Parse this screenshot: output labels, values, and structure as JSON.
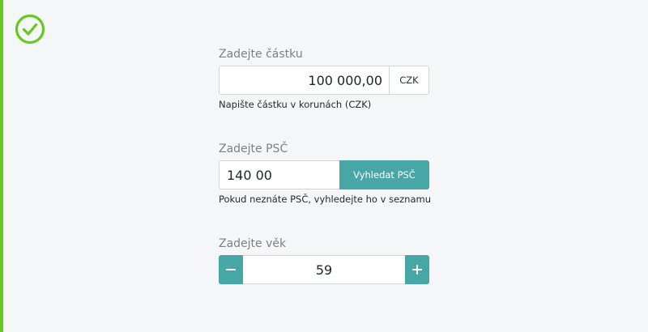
{
  "status": {
    "icon": "check-circle-icon",
    "color": "#66c91f"
  },
  "amount": {
    "label": "Zadejte částku",
    "value": "100 000,00",
    "currency": "CZK",
    "helper": "Napište částku v korunách (CZK)"
  },
  "zip": {
    "label": "Zadejte PSČ",
    "value": "140 00",
    "button_label": "Vyhledat PSČ",
    "helper": "Pokud neznáte PSČ, vyhledejte ho v seznamu"
  },
  "age": {
    "label": "Zadejte věk",
    "value": "59",
    "decrement_icon": "minus-icon",
    "increment_icon": "plus-icon"
  },
  "colors": {
    "accent": "#47a6a6",
    "success": "#66c91f",
    "border": "#cfd4d8"
  }
}
